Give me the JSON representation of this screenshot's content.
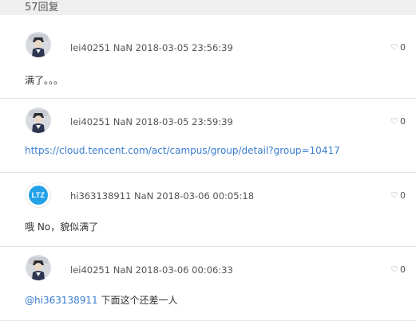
{
  "header": {
    "reply_count": "57回复"
  },
  "replies": [
    {
      "user": "lei40251",
      "extra": "NaN",
      "datetime": "2018-03-05 23:56:39",
      "likes": "0",
      "text": "满了。。。",
      "avatar": "photo"
    },
    {
      "user": "lei40251",
      "extra": "NaN",
      "datetime": "2018-03-05 23:59:39",
      "likes": "0",
      "link": "https://cloud.tencent.com/act/campus/group/detail?group=10417",
      "avatar": "photo"
    },
    {
      "user": "hi363138911",
      "extra": "NaN",
      "datetime": "2018-03-06 00:05:18",
      "likes": "0",
      "text": "哦 No，貌似满了",
      "avatar": "LTZ"
    },
    {
      "user": "lei40251",
      "extra": "NaN",
      "datetime": "2018-03-06 00:06:33",
      "likes": "0",
      "mention": "@hi363138911",
      "text": "下面这个还差一人",
      "avatar": "photo"
    }
  ],
  "icons": {
    "like": "heart-outline-icon"
  },
  "colors": {
    "link": "#3a7ed0",
    "header_bg": "#efefef",
    "ltz_avatar": "#23a2e8"
  }
}
